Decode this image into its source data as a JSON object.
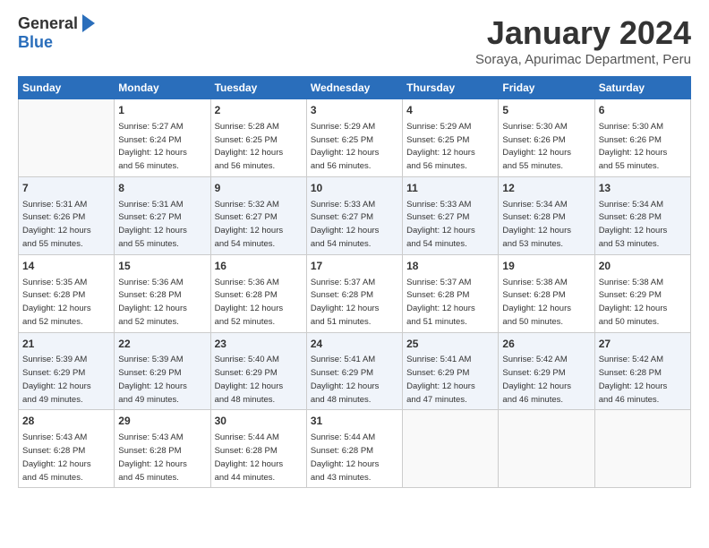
{
  "logo": {
    "general": "General",
    "blue": "Blue"
  },
  "title": "January 2024",
  "location": "Soraya, Apurimac Department, Peru",
  "days_of_week": [
    "Sunday",
    "Monday",
    "Tuesday",
    "Wednesday",
    "Thursday",
    "Friday",
    "Saturday"
  ],
  "weeks": [
    [
      {
        "day": "",
        "info": ""
      },
      {
        "day": "1",
        "info": "Sunrise: 5:27 AM\nSunset: 6:24 PM\nDaylight: 12 hours\nand 56 minutes."
      },
      {
        "day": "2",
        "info": "Sunrise: 5:28 AM\nSunset: 6:25 PM\nDaylight: 12 hours\nand 56 minutes."
      },
      {
        "day": "3",
        "info": "Sunrise: 5:29 AM\nSunset: 6:25 PM\nDaylight: 12 hours\nand 56 minutes."
      },
      {
        "day": "4",
        "info": "Sunrise: 5:29 AM\nSunset: 6:25 PM\nDaylight: 12 hours\nand 56 minutes."
      },
      {
        "day": "5",
        "info": "Sunrise: 5:30 AM\nSunset: 6:26 PM\nDaylight: 12 hours\nand 55 minutes."
      },
      {
        "day": "6",
        "info": "Sunrise: 5:30 AM\nSunset: 6:26 PM\nDaylight: 12 hours\nand 55 minutes."
      }
    ],
    [
      {
        "day": "7",
        "info": "Sunrise: 5:31 AM\nSunset: 6:26 PM\nDaylight: 12 hours\nand 55 minutes."
      },
      {
        "day": "8",
        "info": "Sunrise: 5:31 AM\nSunset: 6:27 PM\nDaylight: 12 hours\nand 55 minutes."
      },
      {
        "day": "9",
        "info": "Sunrise: 5:32 AM\nSunset: 6:27 PM\nDaylight: 12 hours\nand 54 minutes."
      },
      {
        "day": "10",
        "info": "Sunrise: 5:33 AM\nSunset: 6:27 PM\nDaylight: 12 hours\nand 54 minutes."
      },
      {
        "day": "11",
        "info": "Sunrise: 5:33 AM\nSunset: 6:27 PM\nDaylight: 12 hours\nand 54 minutes."
      },
      {
        "day": "12",
        "info": "Sunrise: 5:34 AM\nSunset: 6:28 PM\nDaylight: 12 hours\nand 53 minutes."
      },
      {
        "day": "13",
        "info": "Sunrise: 5:34 AM\nSunset: 6:28 PM\nDaylight: 12 hours\nand 53 minutes."
      }
    ],
    [
      {
        "day": "14",
        "info": "Sunrise: 5:35 AM\nSunset: 6:28 PM\nDaylight: 12 hours\nand 52 minutes."
      },
      {
        "day": "15",
        "info": "Sunrise: 5:36 AM\nSunset: 6:28 PM\nDaylight: 12 hours\nand 52 minutes."
      },
      {
        "day": "16",
        "info": "Sunrise: 5:36 AM\nSunset: 6:28 PM\nDaylight: 12 hours\nand 52 minutes."
      },
      {
        "day": "17",
        "info": "Sunrise: 5:37 AM\nSunset: 6:28 PM\nDaylight: 12 hours\nand 51 minutes."
      },
      {
        "day": "18",
        "info": "Sunrise: 5:37 AM\nSunset: 6:28 PM\nDaylight: 12 hours\nand 51 minutes."
      },
      {
        "day": "19",
        "info": "Sunrise: 5:38 AM\nSunset: 6:28 PM\nDaylight: 12 hours\nand 50 minutes."
      },
      {
        "day": "20",
        "info": "Sunrise: 5:38 AM\nSunset: 6:29 PM\nDaylight: 12 hours\nand 50 minutes."
      }
    ],
    [
      {
        "day": "21",
        "info": "Sunrise: 5:39 AM\nSunset: 6:29 PM\nDaylight: 12 hours\nand 49 minutes."
      },
      {
        "day": "22",
        "info": "Sunrise: 5:39 AM\nSunset: 6:29 PM\nDaylight: 12 hours\nand 49 minutes."
      },
      {
        "day": "23",
        "info": "Sunrise: 5:40 AM\nSunset: 6:29 PM\nDaylight: 12 hours\nand 48 minutes."
      },
      {
        "day": "24",
        "info": "Sunrise: 5:41 AM\nSunset: 6:29 PM\nDaylight: 12 hours\nand 48 minutes."
      },
      {
        "day": "25",
        "info": "Sunrise: 5:41 AM\nSunset: 6:29 PM\nDaylight: 12 hours\nand 47 minutes."
      },
      {
        "day": "26",
        "info": "Sunrise: 5:42 AM\nSunset: 6:29 PM\nDaylight: 12 hours\nand 46 minutes."
      },
      {
        "day": "27",
        "info": "Sunrise: 5:42 AM\nSunset: 6:28 PM\nDaylight: 12 hours\nand 46 minutes."
      }
    ],
    [
      {
        "day": "28",
        "info": "Sunrise: 5:43 AM\nSunset: 6:28 PM\nDaylight: 12 hours\nand 45 minutes."
      },
      {
        "day": "29",
        "info": "Sunrise: 5:43 AM\nSunset: 6:28 PM\nDaylight: 12 hours\nand 45 minutes."
      },
      {
        "day": "30",
        "info": "Sunrise: 5:44 AM\nSunset: 6:28 PM\nDaylight: 12 hours\nand 44 minutes."
      },
      {
        "day": "31",
        "info": "Sunrise: 5:44 AM\nSunset: 6:28 PM\nDaylight: 12 hours\nand 43 minutes."
      },
      {
        "day": "",
        "info": ""
      },
      {
        "day": "",
        "info": ""
      },
      {
        "day": "",
        "info": ""
      }
    ]
  ]
}
